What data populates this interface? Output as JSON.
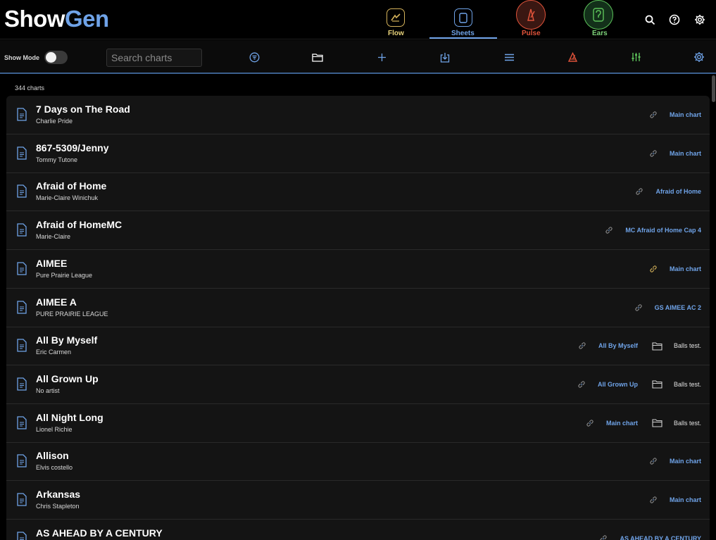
{
  "app": {
    "logo_part1": "Show",
    "logo_part2": "Gen",
    "brand_color": "#6fa3e8"
  },
  "nav": {
    "tabs": [
      {
        "label": "Flow",
        "icon": "flow-icon",
        "color": "#d4b25a"
      },
      {
        "label": "Sheets",
        "icon": "sheets-icon",
        "color": "#6fa3e8",
        "active": true
      },
      {
        "label": "Pulse",
        "icon": "metronome-icon",
        "color": "#e0533a"
      },
      {
        "label": "Ears",
        "icon": "ear-icon",
        "color": "#5cc25a"
      }
    ],
    "actions": [
      "search-icon",
      "help-icon",
      "settings-icon"
    ]
  },
  "toolbar": {
    "show_mode_label": "Show Mode",
    "show_mode_on": false,
    "search_placeholder": "Search charts",
    "buttons": [
      "filter-icon",
      "folder-icon",
      "add-icon",
      "import-icon",
      "menu-icon",
      "metronome-icon",
      "mixer-icon",
      "settings-icon"
    ]
  },
  "count_label": "344 charts",
  "charts": [
    {
      "title": "7 Days on The Road",
      "artist": "Charlie Pride",
      "link": "Main chart",
      "folder": ""
    },
    {
      "title": "867-5309/Jenny",
      "artist": "Tommy Tutone",
      "link": "Main chart",
      "folder": ""
    },
    {
      "title": "Afraid of Home",
      "artist": "Marie-Claire Winichuk",
      "link": "Afraid of Home",
      "folder": ""
    },
    {
      "title": "Afraid of HomeMC",
      "artist": "Marie-Claire",
      "link": "MC Afraid of Home Cap 4",
      "folder": ""
    },
    {
      "title": "AIMEE",
      "artist": "Pure Prairie League",
      "link": "Main chart",
      "folder": "",
      "link_color": "#d4b25a"
    },
    {
      "title": "AIMEE A",
      "artist": "PURE PRAIRIE LEAGUE",
      "link": "GS AIMEE AC 2",
      "folder": ""
    },
    {
      "title": "All By Myself",
      "artist": "Eric Carmen",
      "link": "All By Myself",
      "folder": "Balls test."
    },
    {
      "title": "All Grown Up",
      "artist": "No artist",
      "link": "All Grown Up",
      "folder": "Balls test."
    },
    {
      "title": "All Night Long",
      "artist": "Lionel Richie",
      "link": "Main chart",
      "folder": "Balls test."
    },
    {
      "title": "Allison",
      "artist": "Elvis costello",
      "link": "Main chart",
      "folder": ""
    },
    {
      "title": "Arkansas",
      "artist": "Chris Stapleton",
      "link": "Main chart",
      "folder": ""
    },
    {
      "title": "AS AHEAD BY A CENTURY",
      "artist": "",
      "link": "AS AHEAD BY A CENTURY",
      "folder": ""
    }
  ]
}
